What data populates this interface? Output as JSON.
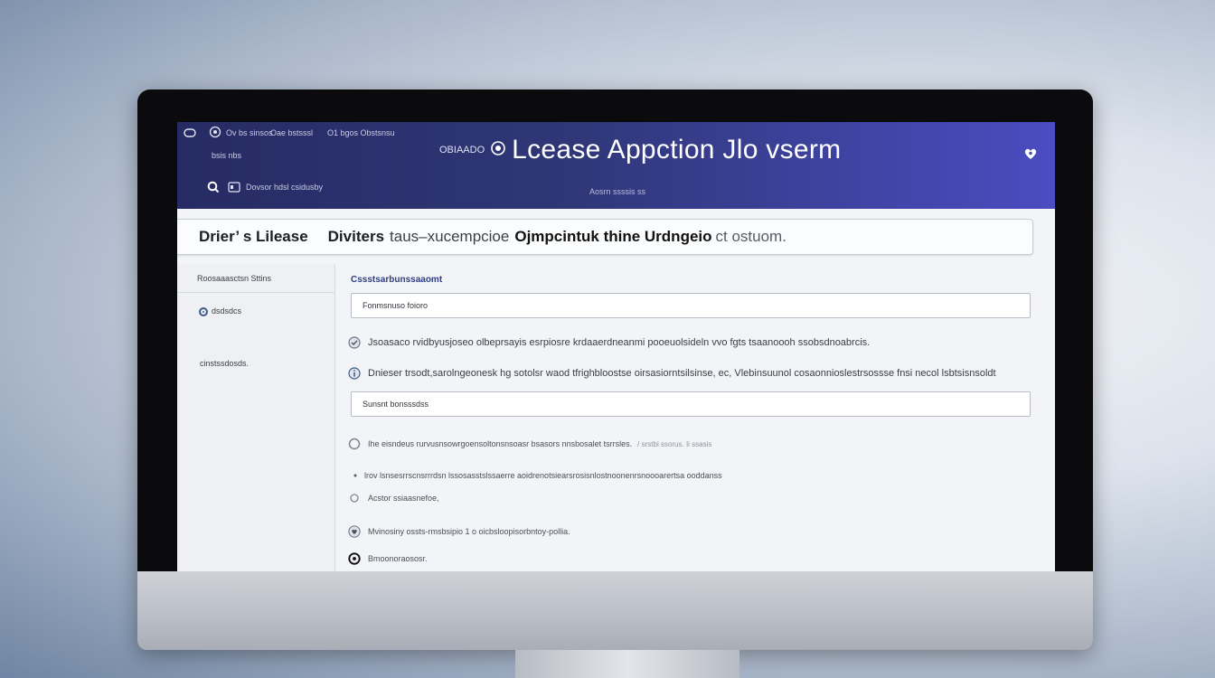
{
  "header": {
    "menu_left": "Ov bs sinsos",
    "menu_mid": "Oae bstsssl",
    "menu_right": "O1 bgos Obstsnsu",
    "sub_item": "bsis nbs",
    "search_text": "Dovsor hdsl csidusby",
    "brand": "OBIAADO",
    "app_title": "Lcease Appction Jlo vserm",
    "subtitle": "Aosrn ssssis ss"
  },
  "banner": {
    "left": "Drier’ s Lilease",
    "mid": "Diviters",
    "light": "taus–xucempcioe",
    "strong": "Ojmpcintuk thine Urdngeio",
    "tail": "ct ostuom."
  },
  "sidebar": {
    "heading": "Roosaaasctsn Sttins",
    "items": [
      {
        "label": "dsdsdcs"
      },
      {
        "label": "cinstssdosds."
      }
    ]
  },
  "main": {
    "section_title": "Cssstsarbunssaaomt",
    "field1_value": "Fonmsnuso foioro",
    "line1": "Jsoasaco rvidbyusjoseo olbeprsayis esrpiosre krdaaerdneanmi pooeuolsideln vvo fgts tsaanoooh ssobsdnoabrcis.",
    "line2": "Dnieser trsodt,sarolngeonesk hg sotolsr waod tfrighbloostse oirsasiorntsilsinse, ec, Vlebinsuunol cosaonnioslestrsossse fnsi necol lsbtsisnsoldt",
    "field2_value": "Sunsnt bonsssdss",
    "line3": "Ihe eisndeus rurvusnsowrgoensoltonsnsoasr bsasors nnsbosalet tsrrsles.",
    "line3_faint": "/ srstbi ssorus. Ii ssasis",
    "line4": "lrov lsnsesrrscnsrrrdsn lssosasstslssaerre aoidrenotsiearsrosisnlostnoonenrsnoooarertsa ooddanss",
    "line5": "Acstor ssiaasnefoe,",
    "line6": "Mvinosiny ossts-rmsbsipio 1 o oicbsloopisorbntoy-pollia.",
    "line7": "Bmoonoraososr."
  },
  "colors": {
    "topbar_start": "#262b63",
    "topbar_end": "#4b4cc0",
    "accent": "#2e3f86"
  }
}
